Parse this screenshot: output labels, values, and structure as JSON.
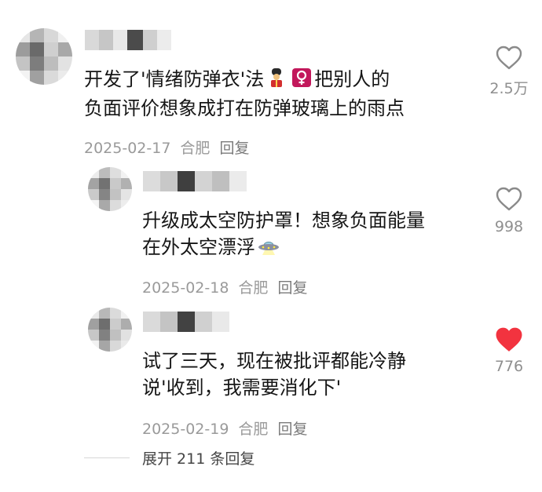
{
  "comments": [
    {
      "text_line1": "开发了'情绪防弹衣'法",
      "text_line1_tail": "把别人的",
      "text_line2": "负面评价想象成打在防弹玻璃上的雨点",
      "date": "2025-02-17",
      "location": "合肥",
      "reply": "回复",
      "likes": "2.5万",
      "liked": false,
      "emoji_icons": [
        "guard-emoji-icon",
        "female-sign-emoji-icon"
      ]
    },
    {
      "text_line1": "升级成太空防护罩！想象负面能量",
      "text_line2": "在外太空漂浮",
      "date": "2025-02-18",
      "location": "合肥",
      "reply": "回复",
      "likes": "998",
      "liked": false,
      "emoji_icons": [
        "ufo-emoji-icon"
      ]
    },
    {
      "text_line1": "试了三天，现在被批评都能冷静",
      "text_line2": "说'收到，我需要消化下'",
      "date": "2025-02-19",
      "location": "合肥",
      "reply": "回复",
      "likes": "776",
      "liked": true,
      "emoji_icons": []
    }
  ],
  "expand_replies": "展开 211 条回复",
  "colors": {
    "liked_heart": "#f2333f",
    "meta_gray": "#9a9a9a",
    "text": "#161616"
  }
}
